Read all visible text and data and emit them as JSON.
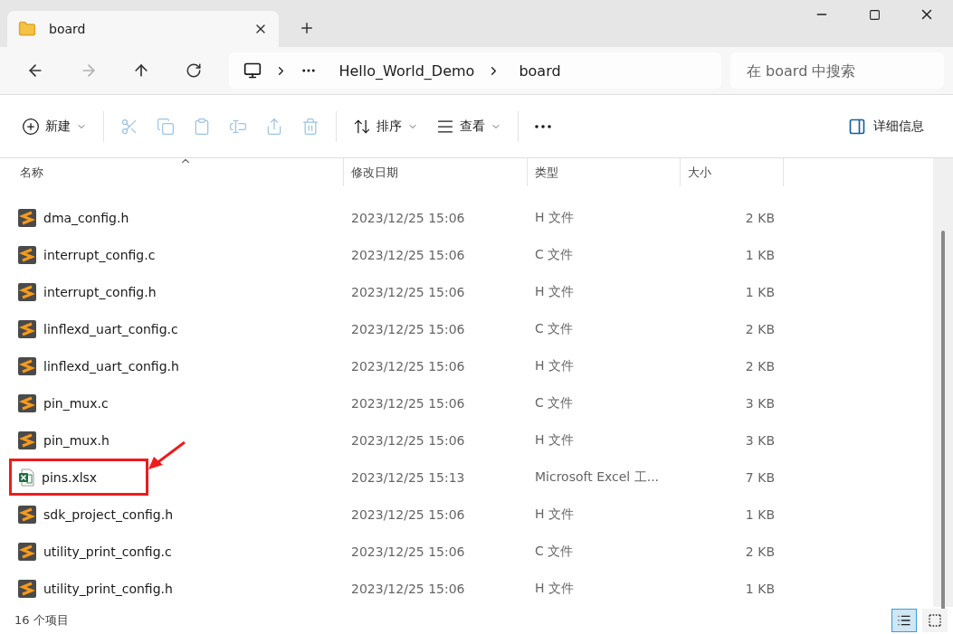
{
  "tab": {
    "title": "board",
    "selected": true
  },
  "address": {
    "segments": [
      "Hello_World_Demo",
      "board"
    ]
  },
  "search": {
    "placeholder": "在 board 中搜索"
  },
  "toolbar": [
    {
      "kind": "new",
      "label": "新建",
      "disabled": false
    },
    {
      "kind": "cut",
      "disabled": true
    },
    {
      "kind": "copy",
      "disabled": true
    },
    {
      "kind": "paste",
      "disabled": true
    },
    {
      "kind": "rename",
      "disabled": true
    },
    {
      "kind": "share",
      "disabled": true
    },
    {
      "kind": "delete",
      "disabled": true
    },
    {
      "kind": "sort",
      "label": "排序",
      "disabled": false
    },
    {
      "kind": "view",
      "label": "查看",
      "disabled": false
    },
    {
      "kind": "more",
      "disabled": false
    }
  ],
  "details_button": {
    "label": "详细信息"
  },
  "columns": [
    "名称",
    "修改日期",
    "类型",
    "大小"
  ],
  "files": [
    {
      "name": "dma_config.h",
      "date": "2023/12/25 15:06",
      "type": "H 文件",
      "size": "2 KB",
      "kind": "source",
      "highlighted": false
    },
    {
      "name": "interrupt_config.c",
      "date": "2023/12/25 15:06",
      "type": "C 文件",
      "size": "1 KB",
      "kind": "source",
      "highlighted": false
    },
    {
      "name": "interrupt_config.h",
      "date": "2023/12/25 15:06",
      "type": "H 文件",
      "size": "1 KB",
      "kind": "source",
      "highlighted": false
    },
    {
      "name": "linflexd_uart_config.c",
      "date": "2023/12/25 15:06",
      "type": "C 文件",
      "size": "2 KB",
      "kind": "source",
      "highlighted": false
    },
    {
      "name": "linflexd_uart_config.h",
      "date": "2023/12/25 15:06",
      "type": "H 文件",
      "size": "2 KB",
      "kind": "source",
      "highlighted": false
    },
    {
      "name": "pin_mux.c",
      "date": "2023/12/25 15:06",
      "type": "C 文件",
      "size": "3 KB",
      "kind": "source",
      "highlighted": false
    },
    {
      "name": "pin_mux.h",
      "date": "2023/12/25 15:06",
      "type": "H 文件",
      "size": "3 KB",
      "kind": "source",
      "highlighted": false
    },
    {
      "name": "pins.xlsx",
      "date": "2023/12/25 15:13",
      "type": "Microsoft Excel 工...",
      "size": "7 KB",
      "kind": "excel",
      "highlighted": true
    },
    {
      "name": "sdk_project_config.h",
      "date": "2023/12/25 15:06",
      "type": "H 文件",
      "size": "1 KB",
      "kind": "source",
      "highlighted": false
    },
    {
      "name": "utility_print_config.c",
      "date": "2023/12/25 15:06",
      "type": "C 文件",
      "size": "2 KB",
      "kind": "source",
      "highlighted": false
    },
    {
      "name": "utility_print_config.h",
      "date": "2023/12/25 15:06",
      "type": "H 文件",
      "size": "1 KB",
      "kind": "source",
      "highlighted": false
    }
  ],
  "status": {
    "count": "16 个项目"
  },
  "view_modes": [
    {
      "kind": "details",
      "selected": true
    },
    {
      "kind": "tiles",
      "selected": false
    }
  ]
}
